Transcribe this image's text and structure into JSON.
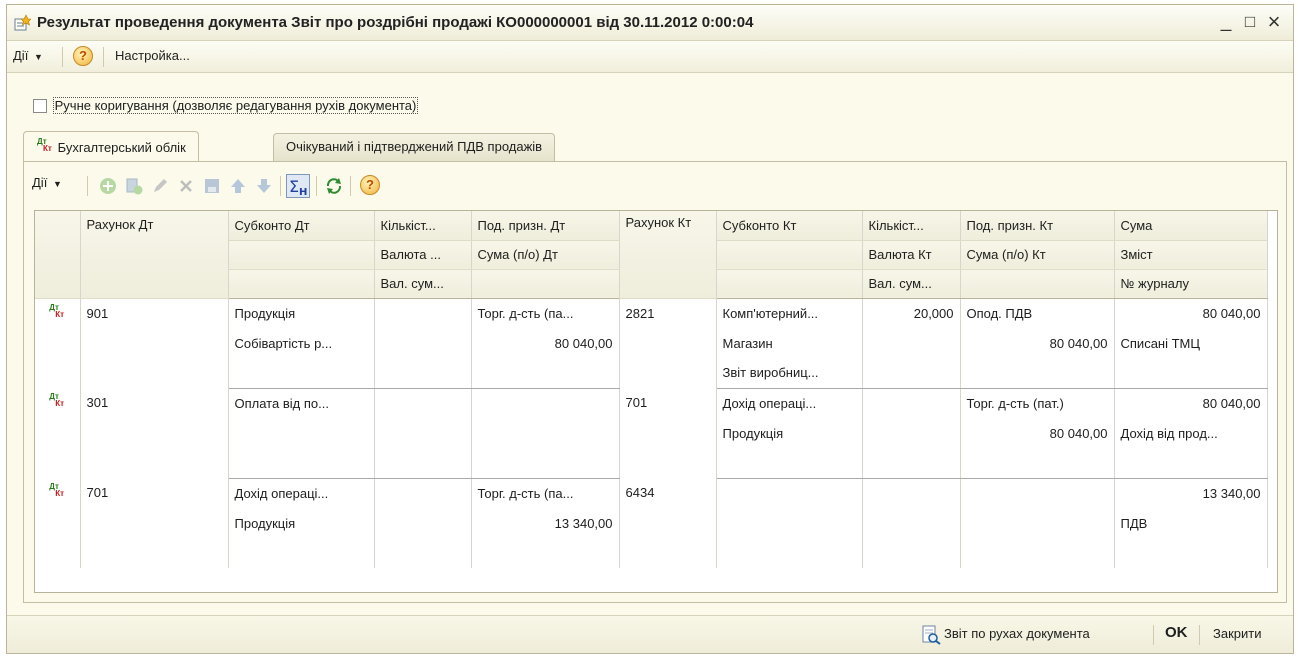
{
  "window": {
    "title": "Результат проведення документа Звіт про роздрібні продажі КО000000001 від 30.11.2012 0:00:04",
    "minimize": "_",
    "maximize": "□",
    "close": "×"
  },
  "menubar": {
    "actions": "Дії",
    "settings": "Настройка..."
  },
  "manual_edit": {
    "label": "Ручне коригування (дозволяє редагування рухів документа)",
    "checked": false
  },
  "tabs": [
    {
      "label": "Бухгалтерський облік",
      "active": true
    },
    {
      "label": "Очікуваний і підтверджений ПДВ продажів",
      "active": false
    }
  ],
  "toolbar": {
    "actions": "Дії"
  },
  "grid": {
    "headers": {
      "r1": [
        "Рахунок Дт",
        "Субконто Дт",
        "Кількіст...",
        "Под. призн. Дт",
        "Рахунок Кт",
        "Субконто Кт",
        "Кількіст...",
        "Под. призн. Кт",
        "Сума"
      ],
      "r2": [
        "Валюта ...",
        "Сума (п/о) Дт",
        "Валюта Кт",
        "Сума (п/о) Кт",
        "Зміст"
      ],
      "r3": [
        "Вал. сум...",
        "Вал. сум...",
        "№ журналу"
      ]
    },
    "records": [
      {
        "dt_account": "901",
        "kt_account": "2821",
        "rows": [
          {
            "sub_dt": "Продукція",
            "qty_dt": "",
            "tax_dt": "Торг. д-сть (па...",
            "sub_kt": "Комп'ютерний...",
            "qty_kt": "20,000",
            "tax_kt": "Опод. ПДВ",
            "sum": "80 040,00"
          },
          {
            "sub_dt": "Собівартість р...",
            "qty_dt": "",
            "tax_dt": "80 040,00",
            "sub_kt": "Магазин",
            "qty_kt": "",
            "tax_kt": "80 040,00",
            "sum": "Списані ТМЦ"
          },
          {
            "sub_dt": "",
            "qty_dt": "",
            "tax_dt": "",
            "sub_kt": "Звіт виробниц...",
            "qty_kt": "",
            "tax_kt": "",
            "sum": ""
          }
        ]
      },
      {
        "dt_account": "301",
        "kt_account": "701",
        "rows": [
          {
            "sub_dt": "Оплата від по...",
            "qty_dt": "",
            "tax_dt": "",
            "sub_kt": "Дохід операці...",
            "qty_kt": "",
            "tax_kt": "Торг. д-сть (пат.)",
            "sum": "80 040,00"
          },
          {
            "sub_dt": "",
            "qty_dt": "",
            "tax_dt": "",
            "sub_kt": "Продукція",
            "qty_kt": "",
            "tax_kt": "80 040,00",
            "sum": "Дохід від прод..."
          },
          {
            "sub_dt": "",
            "qty_dt": "",
            "tax_dt": "",
            "sub_kt": "",
            "qty_kt": "",
            "tax_kt": "",
            "sum": ""
          }
        ]
      },
      {
        "dt_account": "701",
        "kt_account": "6434",
        "rows": [
          {
            "sub_dt": "Дохід операці...",
            "qty_dt": "",
            "tax_dt": "Торг. д-сть (па...",
            "sub_kt": "",
            "qty_kt": "",
            "tax_kt": "",
            "sum": "13 340,00"
          },
          {
            "sub_dt": "Продукція",
            "qty_dt": "",
            "tax_dt": "13 340,00",
            "sub_kt": "",
            "qty_kt": "",
            "tax_kt": "",
            "sum": "ПДВ"
          },
          {
            "sub_dt": "",
            "qty_dt": "",
            "tax_dt": "",
            "sub_kt": "",
            "qty_kt": "",
            "tax_kt": "",
            "sum": ""
          }
        ]
      }
    ]
  },
  "footer": {
    "report_link": "Звіт по рухах документа",
    "ok": "OK",
    "close": "Закрити"
  }
}
